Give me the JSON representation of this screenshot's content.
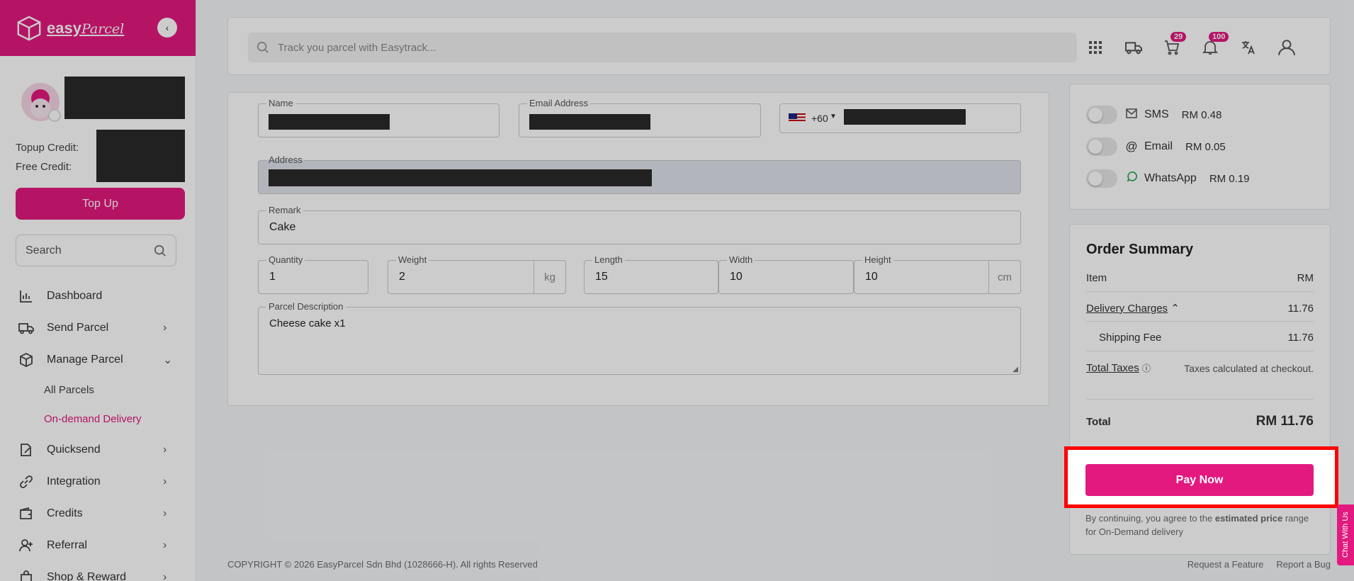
{
  "sidebar": {
    "brand": "easyParcel",
    "topup_credit_label": "Topup Credit:",
    "free_credit_label": "Free Credit:",
    "topup_button": "Top Up",
    "search_placeholder": "Search",
    "nav": [
      {
        "label": "Dashboard",
        "icon": "chart-icon"
      },
      {
        "label": "Send Parcel",
        "icon": "truck-icon"
      },
      {
        "label": "Manage Parcel",
        "icon": "box-icon"
      },
      {
        "label": "Quicksend",
        "icon": "edit-icon"
      },
      {
        "label": "Integration",
        "icon": "link-icon"
      },
      {
        "label": "Credits",
        "icon": "wallet-icon"
      },
      {
        "label": "Referral",
        "icon": "user-plus-icon"
      },
      {
        "label": "Shop & Reward",
        "icon": "bag-icon"
      }
    ],
    "sub": [
      {
        "label": "All Parcels"
      },
      {
        "label": "On-demand Delivery"
      }
    ]
  },
  "topbar": {
    "track_placeholder": "Track you parcel with Easytrack...",
    "cart_count": "29",
    "notif_count": "100"
  },
  "form": {
    "name_label": "Name",
    "email_label": "Email Address",
    "phone_code": "+60",
    "address_label": "Address",
    "remark_label": "Remark",
    "remark_value": "Cake",
    "quantity_label": "Quantity",
    "quantity_value": "1",
    "weight_label": "Weight",
    "weight_value": "2",
    "weight_unit": "kg",
    "length_label": "Length",
    "length_value": "15",
    "width_label": "Width",
    "width_value": "10",
    "height_label": "Height",
    "height_value": "10",
    "dim_unit": "cm",
    "desc_label": "Parcel Description",
    "desc_value": "Cheese cake x1"
  },
  "notify": [
    {
      "label": "SMS",
      "price": "RM 0.48",
      "icon": "mail-icon"
    },
    {
      "label": "Email",
      "price": "RM 0.05",
      "icon": "at-icon"
    },
    {
      "label": "WhatsApp",
      "price": "RM 0.19",
      "icon": "whatsapp-icon"
    }
  ],
  "summary": {
    "title": "Order Summary",
    "item_label": "Item",
    "item_currency": "RM",
    "delivery_label": "Delivery Charges",
    "delivery_value": "11.76",
    "shipping_label": "Shipping Fee",
    "shipping_value": "11.76",
    "taxes_label": "Total Taxes",
    "taxes_value": "Taxes calculated at checkout.",
    "total_label": "Total",
    "total_value": "RM 11.76",
    "pay_button": "Pay Now",
    "terms_prefix": "By continuing, you agree to the ",
    "terms_bold": "estimated price",
    "terms_suffix": " range for On-Demand delivery"
  },
  "chat_tab": "Chat With Us",
  "footer": {
    "copyright": "COPYRIGHT © 2026 EasyParcel Sdn Bhd (1028666-H). All rights Reserved",
    "request_feature": "Request a Feature",
    "report_bug": "Report a Bug"
  },
  "colors": {
    "brand": "#e3197f",
    "highlight": "#ff0000"
  }
}
